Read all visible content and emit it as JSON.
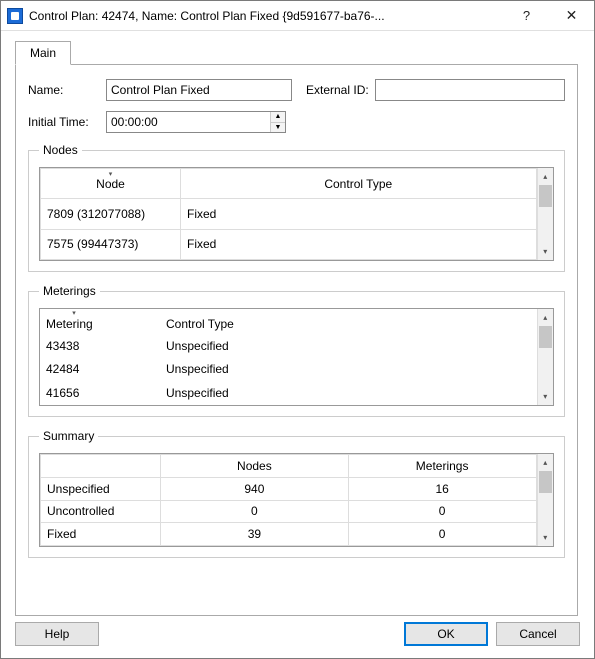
{
  "titlebar": {
    "title": "Control Plan: 42474, Name: Control Plan Fixed  {9d591677-ba76-...",
    "help_symbol": "?",
    "close_symbol": "✕"
  },
  "tabs": {
    "main": "Main"
  },
  "form": {
    "name_label": "Name:",
    "name_value": "Control Plan Fixed",
    "external_id_label": "External ID:",
    "external_id_value": "",
    "initial_time_label": "Initial Time:",
    "initial_time_value": "00:00:00",
    "spinner_up": "▲",
    "spinner_down": "▼"
  },
  "nodes_group": {
    "legend": "Nodes",
    "headers": {
      "node": "Node",
      "control_type": "Control Type"
    },
    "rows": [
      {
        "node": "7809 (312077088)",
        "control_type": "Fixed"
      },
      {
        "node": "7575 (99447373)",
        "control_type": "Fixed"
      }
    ]
  },
  "meterings_group": {
    "legend": "Meterings",
    "headers": {
      "metering": "Metering",
      "control_type": "Control Type"
    },
    "rows": [
      {
        "metering": "43438",
        "control_type": "Unspecified"
      },
      {
        "metering": "42484",
        "control_type": "Unspecified"
      },
      {
        "metering": "41656",
        "control_type": "Unspecified"
      }
    ]
  },
  "summary_group": {
    "legend": "Summary",
    "headers": {
      "blank": "",
      "nodes": "Nodes",
      "meterings": "Meterings"
    },
    "rows": [
      {
        "label": "Unspecified",
        "nodes": "940",
        "meterings": "16"
      },
      {
        "label": "Uncontrolled",
        "nodes": "0",
        "meterings": "0"
      },
      {
        "label": "Fixed",
        "nodes": "39",
        "meterings": "0"
      }
    ]
  },
  "buttons": {
    "help": "Help",
    "ok": "OK",
    "cancel": "Cancel"
  },
  "scroll": {
    "up": "▴",
    "down": "▾"
  }
}
